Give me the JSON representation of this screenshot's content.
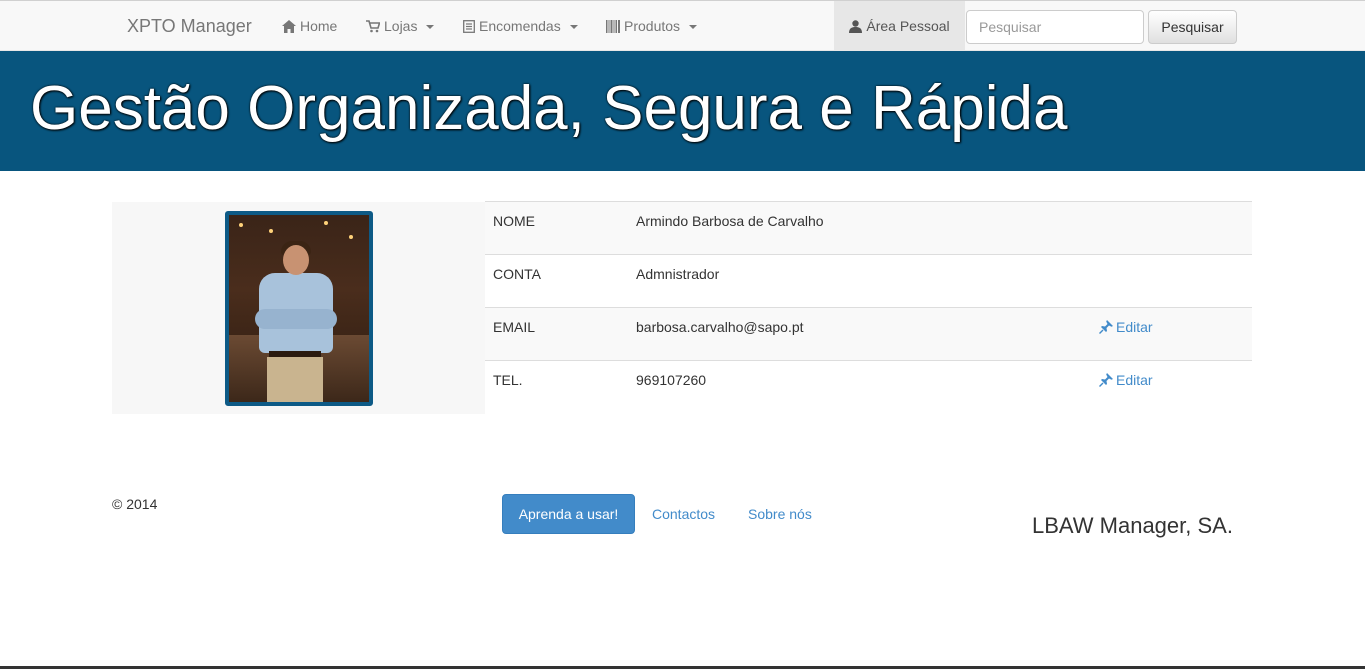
{
  "navbar": {
    "brand": "XPTO Manager",
    "home": "Home",
    "lojas": "Lojas",
    "encomendas": "Encomendas",
    "produtos": "Produtos",
    "area_pessoal": "Área Pessoal",
    "search_placeholder": "Pesquisar",
    "search_button": "Pesquisar"
  },
  "banner": {
    "title": "Gestão Organizada, Segura e Rápida",
    "color": "#08557e"
  },
  "profile": {
    "rows": [
      {
        "label": "NOME",
        "value": "Armindo Barbosa de Carvalho"
      },
      {
        "label": "CONTA",
        "value": "Admnistrador"
      },
      {
        "label": "EMAIL",
        "value": "barbosa.carvalho@sapo.pt",
        "action": "Editar"
      },
      {
        "label": "TEL.",
        "value": "969107260",
        "action": "Editar"
      }
    ]
  },
  "footer": {
    "copyright": "© 2014",
    "learn_button": "Aprenda a usar!",
    "contactos": "Contactos",
    "sobre": "Sobre nós",
    "company": "LBAW Manager, SA."
  },
  "icons": {
    "home": "home-icon",
    "lojas": "cart-icon",
    "encomendas": "list-icon",
    "produtos": "barcode-icon",
    "area_pessoal": "user-icon",
    "edit": "pushpin-icon"
  }
}
